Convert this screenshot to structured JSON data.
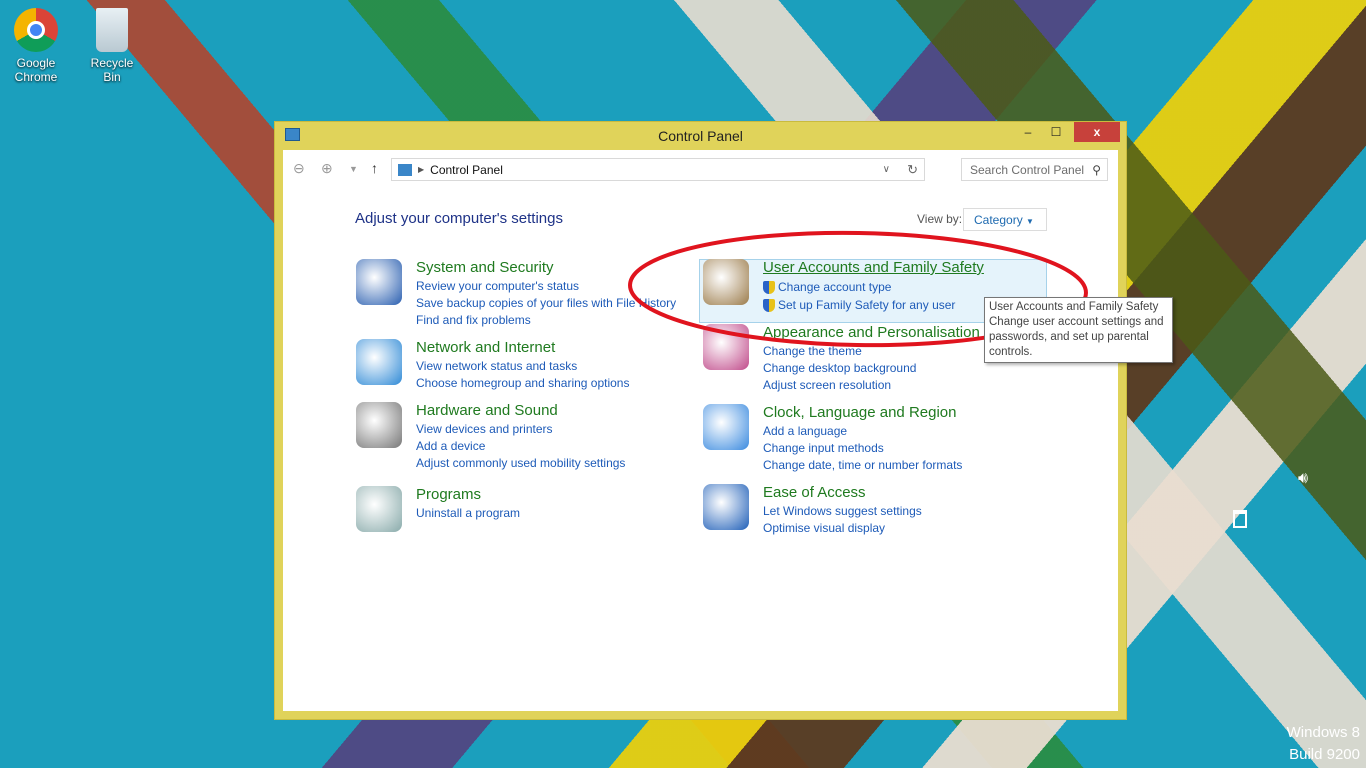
{
  "desktop": {
    "icons": [
      {
        "label": "Google Chrome"
      },
      {
        "label": "Recycle Bin"
      }
    ],
    "watermark": [
      "Windows 8",
      "Build 9200"
    ]
  },
  "window": {
    "title": "Control Panel",
    "min": "–",
    "max": "☐",
    "close": "x",
    "address": {
      "path": "Control Panel"
    },
    "search_placeholder": "Search Control Panel",
    "heading": "Adjust your computer's settings",
    "view_by_label": "View by:",
    "view_by_value": "Category",
    "categories_left": [
      {
        "title": "System and Security",
        "links": [
          "Review your computer's status",
          "Save backup copies of your files with File History",
          "Find and fix problems"
        ]
      },
      {
        "title": "Network and Internet",
        "links": [
          "View network status and tasks",
          "Choose homegroup and sharing options"
        ]
      },
      {
        "title": "Hardware and Sound",
        "links": [
          "View devices and printers",
          "Add a device",
          "Adjust commonly used mobility settings"
        ]
      },
      {
        "title": "Programs",
        "links": [
          "Uninstall a program"
        ]
      }
    ],
    "categories_right": [
      {
        "title": "User Accounts and Family Safety",
        "links": [
          "Change account type",
          "Set up Family Safety for any user"
        ]
      },
      {
        "title": "Appearance and Personalisation",
        "links": [
          "Change the theme",
          "Change desktop background",
          "Adjust screen resolution"
        ]
      },
      {
        "title": "Clock, Language and Region",
        "links": [
          "Add a language",
          "Change input methods",
          "Change date, time or number formats"
        ]
      },
      {
        "title": "Ease of Access",
        "links": [
          "Let Windows suggest settings",
          "Optimise visual display"
        ]
      }
    ]
  },
  "tooltip": {
    "title": "User Accounts and Family Safety",
    "body": "Change user account settings and passwords, and set up parental controls."
  },
  "colors": {
    "annotation": "#e0141e",
    "accent": "#e0d35a"
  }
}
